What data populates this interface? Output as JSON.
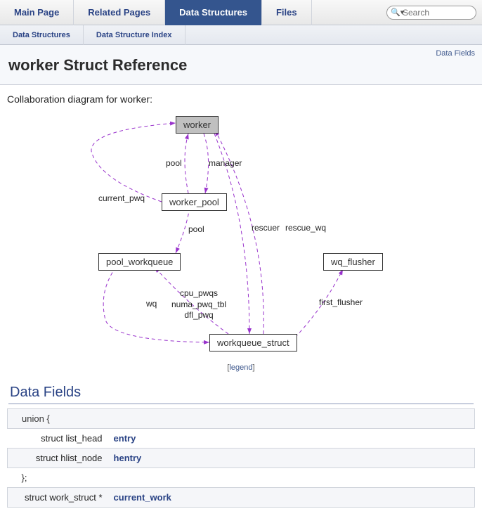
{
  "tabs": {
    "main": [
      {
        "label": "Main Page"
      },
      {
        "label": "Related Pages"
      },
      {
        "label": "Data Structures",
        "active": true
      },
      {
        "label": "Files"
      }
    ],
    "sub": [
      {
        "label": "Data Structures"
      },
      {
        "label": "Data Structure Index"
      }
    ]
  },
  "search": {
    "placeholder": "Search"
  },
  "header": {
    "data_fields_link": "Data Fields",
    "title": "worker Struct Reference"
  },
  "collab_text": "Collaboration diagram for worker:",
  "legend": {
    "open": "[",
    "label": "legend",
    "close": "]"
  },
  "diagram": {
    "nodes": {
      "worker": "worker",
      "worker_pool": "worker_pool",
      "pool_workqueue": "pool_workqueue",
      "workqueue_struct": "workqueue_struct",
      "wq_flusher": "wq_flusher"
    },
    "labels": {
      "pool": "pool",
      "manager": "manager",
      "current_pwq": "current_pwq",
      "pool2": "pool",
      "rescuer": "rescuer",
      "rescue_wq": "rescue_wq",
      "wq": "wq",
      "cpu_pwqs": "cpu_pwqs\nnuma_pwq_tbl\ndfl_pwq",
      "first_flusher": "first_flusher"
    }
  },
  "section": {
    "data_fields": "Data Fields"
  },
  "fields": {
    "union_open": "union {",
    "entry_type": "struct list_head",
    "entry_name": "entry",
    "hentry_type": "struct hlist_node",
    "hentry_name": "hentry",
    "union_close": "};",
    "current_work_type": "struct work_struct *",
    "current_work_name": "current_work"
  }
}
